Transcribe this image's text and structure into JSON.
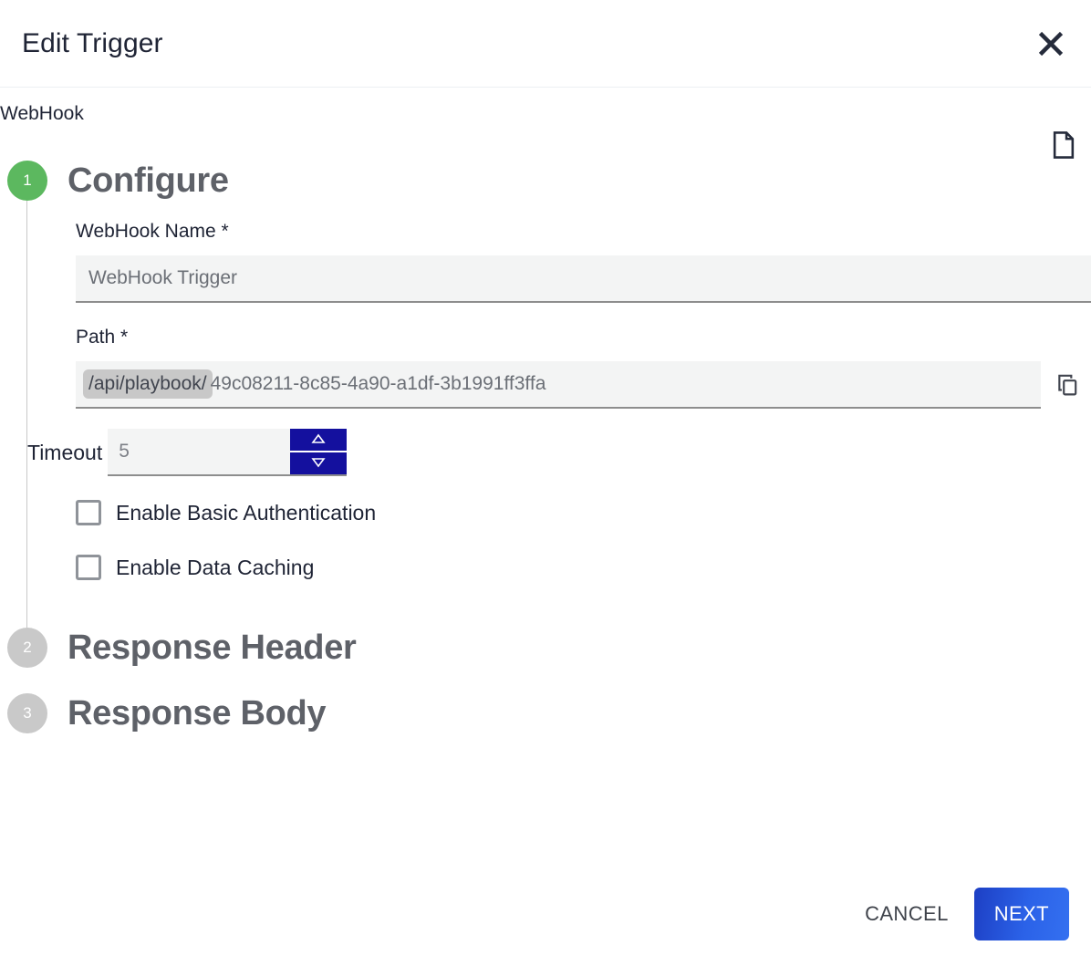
{
  "dialog": {
    "title": "Edit Trigger",
    "subtitle": "WebHook",
    "close_icon": "close-icon",
    "doc_icon": "document-icon"
  },
  "steps": [
    {
      "number": "1",
      "label": "Configure",
      "state": "active"
    },
    {
      "number": "2",
      "label": "Response Header",
      "state": "inactive"
    },
    {
      "number": "3",
      "label": "Response Body",
      "state": "inactive"
    }
  ],
  "configure": {
    "name_field": {
      "label": "WebHook Name *",
      "value": "WebHook Trigger",
      "placeholder": "WebHook Trigger"
    },
    "path_field": {
      "label": "Path *",
      "prefix": "/api/playbook/",
      "value": "49c08211-8c85-4a90-a1df-3b1991ff3ffa",
      "copy_icon": "copy-icon"
    },
    "timeout_field": {
      "label": "Timeout",
      "value": "5",
      "increment_icon": "triangle-up-icon",
      "decrement_icon": "triangle-down-icon"
    },
    "checkboxes": [
      {
        "label": "Enable Basic Authentication",
        "checked": false
      },
      {
        "label": "Enable Data Caching",
        "checked": false
      }
    ]
  },
  "footer": {
    "cancel_label": "CANCEL",
    "next_label": "NEXT"
  },
  "colors": {
    "step_active": "#5cb85f",
    "step_inactive": "#c9c9c9",
    "primary_button": "#2b62e8",
    "spinner": "#14109e",
    "field_background": "#f3f4f4",
    "prefix_chip": "#c8c8c8"
  }
}
